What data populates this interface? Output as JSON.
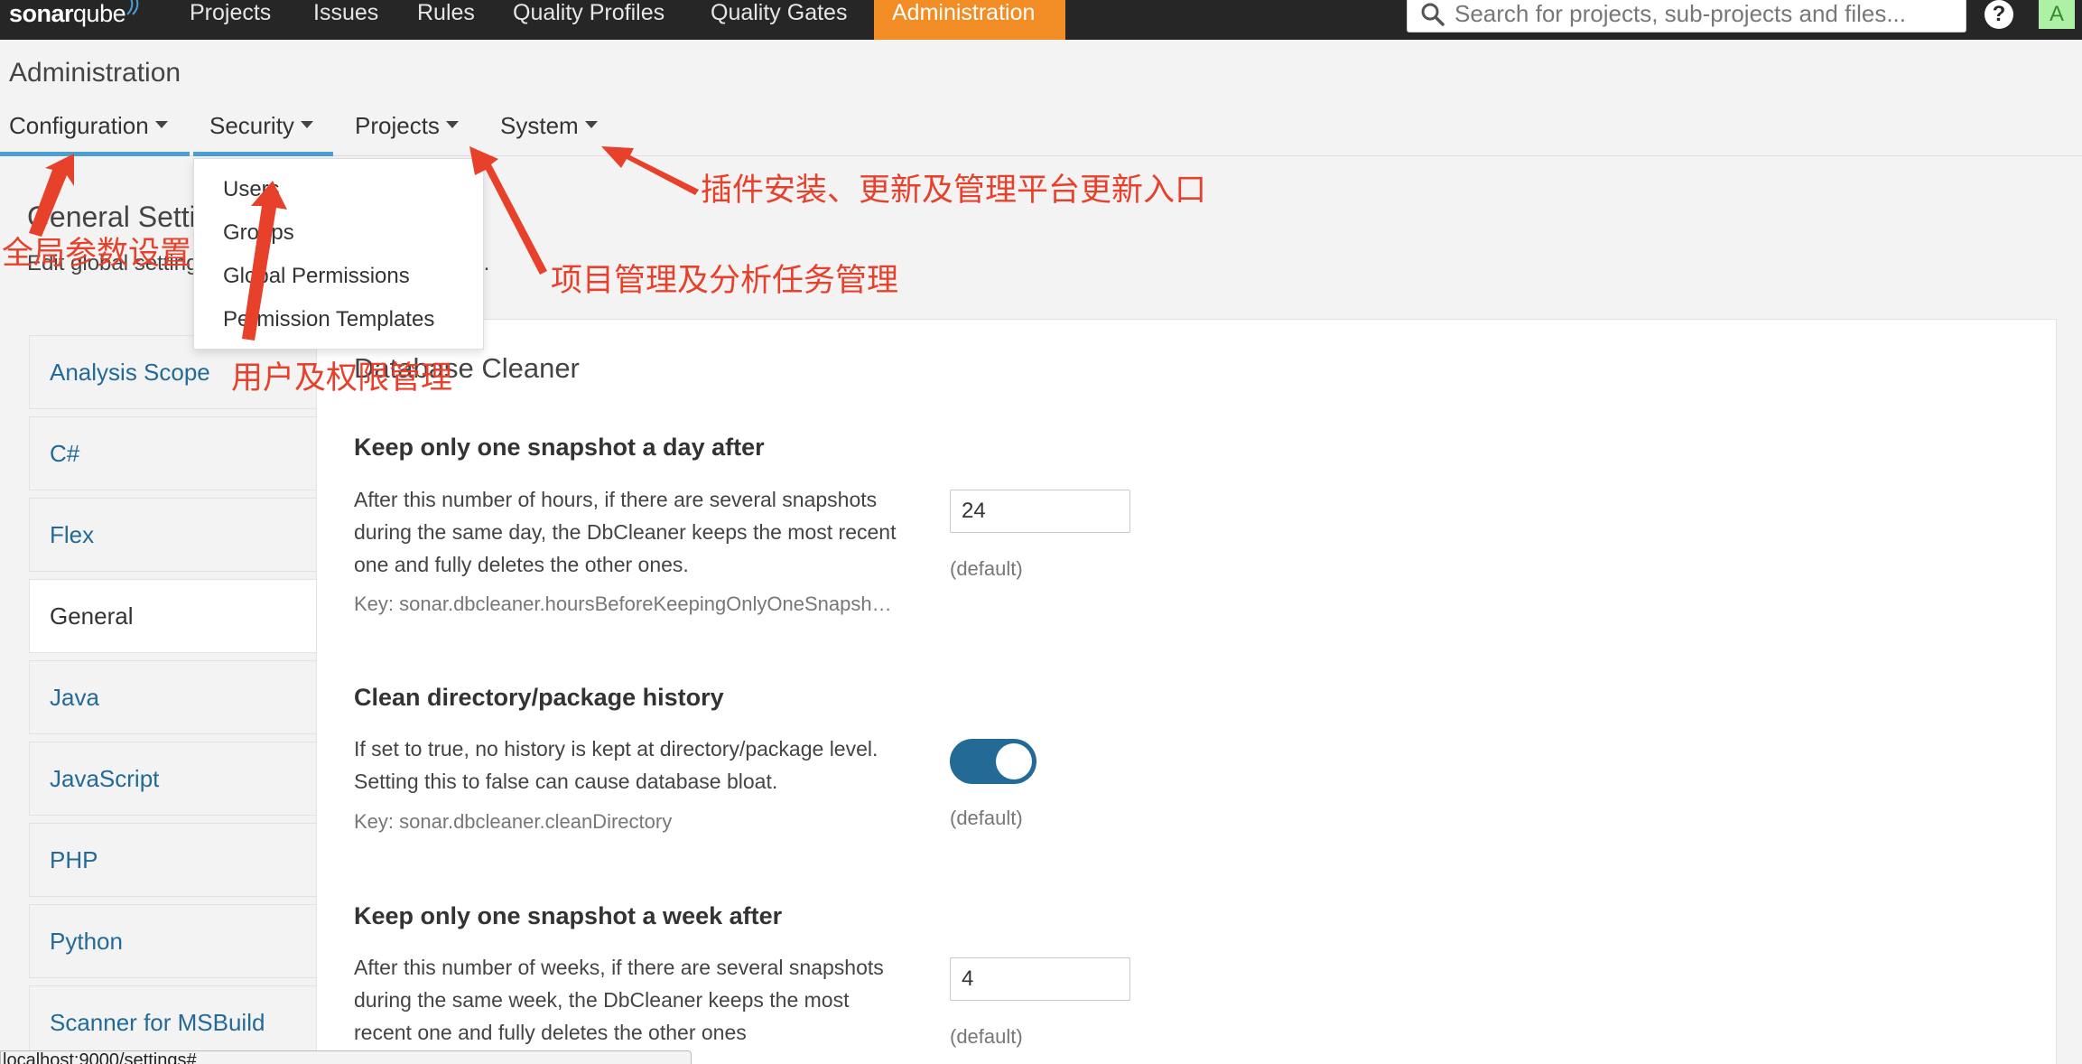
{
  "topbar": {
    "logo_main": "sonar",
    "logo_suffix": "qube",
    "nav": [
      "Projects",
      "Issues",
      "Rules",
      "Quality Profiles",
      "Quality Gates",
      "Administration"
    ],
    "active_nav": "Administration",
    "search_placeholder": "Search for projects, sub-projects and files...",
    "help_label": "?",
    "avatar_letter": "A"
  },
  "admin": {
    "title": "Administration",
    "tabs": [
      "Configuration",
      "Security",
      "Projects",
      "System"
    ]
  },
  "security_menu": [
    "Users",
    "Groups",
    "Global Permissions",
    "Permission Templates"
  ],
  "page": {
    "title": "General Settings",
    "description": "Edit global settings for this SonarQube instance."
  },
  "sidebar": [
    "Analysis Scope",
    "C#",
    "Flex",
    "General",
    "Java",
    "JavaScript",
    "PHP",
    "Python",
    "Scanner for MSBuild"
  ],
  "sidebar_active": "General",
  "panel": {
    "title": "Database Cleaner",
    "settings": [
      {
        "name": "Keep only one snapshot a day after",
        "desc": "After this number of hours, if there are several snapshots during the same day, the DbCleaner keeps the most recent one and fully deletes the other ones.",
        "key": "Key: sonar.dbcleaner.hoursBeforeKeepingOnlyOneSnapshotByDay",
        "value": "24",
        "default": "(default)"
      },
      {
        "name": "Clean directory/package history",
        "desc": "If set to true, no history is kept at directory/package level. Setting this to false can cause database bloat.",
        "key": "Key: sonar.dbcleaner.cleanDirectory",
        "value": "true",
        "default": "(default)"
      },
      {
        "name": "Keep only one snapshot a week after",
        "desc": "After this number of weeks, if there are several snapshots during the same week, the DbCleaner keeps the most recent one and fully deletes the other ones",
        "value": "4",
        "default": "(default)"
      }
    ]
  },
  "status_url": "localhost:9000/settings#",
  "annotations": {
    "global": "全局参数设置",
    "users": "用户及权限管理",
    "projects": "项目管理及分析任务管理",
    "system": "插件安装、更新及管理平台更新入口"
  },
  "colors": {
    "navbar": "#262626",
    "active_nav": "#f28d26",
    "link": "#236a97",
    "toggle": "#236a97",
    "annotation": "#e8412b",
    "underline": "#4b9fd5"
  }
}
